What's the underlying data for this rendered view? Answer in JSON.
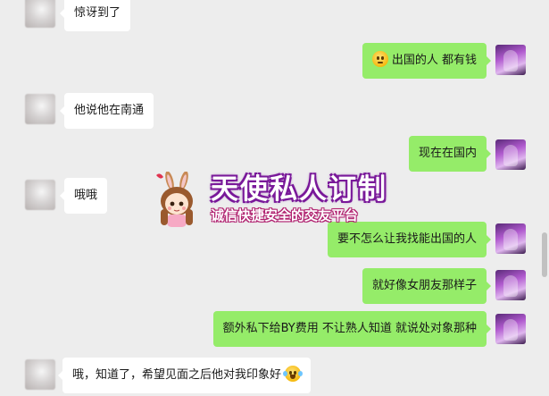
{
  "messages": [
    {
      "side": "left",
      "text": "惊讶到了",
      "emoji": ""
    },
    {
      "side": "right",
      "text": "出国的人 都有钱",
      "emoji": "rolling-eyes-emoji"
    },
    {
      "side": "left",
      "text": "他说他在南通",
      "emoji": ""
    },
    {
      "side": "right",
      "text": "现在在国内",
      "emoji": ""
    },
    {
      "side": "left",
      "text": "哦哦",
      "emoji": ""
    },
    {
      "side": "right",
      "text": "要不怎么让我找能出国的人",
      "emoji": ""
    },
    {
      "side": "right",
      "text": "就好像女朋友那样子",
      "emoji": ""
    },
    {
      "side": "right",
      "text": "额外私下给BY费用 不让熟人知道 就说处对象那种",
      "emoji": ""
    },
    {
      "side": "left",
      "text": "哦，知道了，希望见面之后他对我印象好",
      "emoji": "laughing-tears-emoji"
    }
  ],
  "watermark": {
    "title": "天使私人订制",
    "subtitle": "诚信快捷安全的交友平台"
  },
  "colors": {
    "background": "#ededed",
    "self_bubble": "#95ec69",
    "other_bubble": "#ffffff",
    "watermark_purple": "#7a1a9a"
  }
}
